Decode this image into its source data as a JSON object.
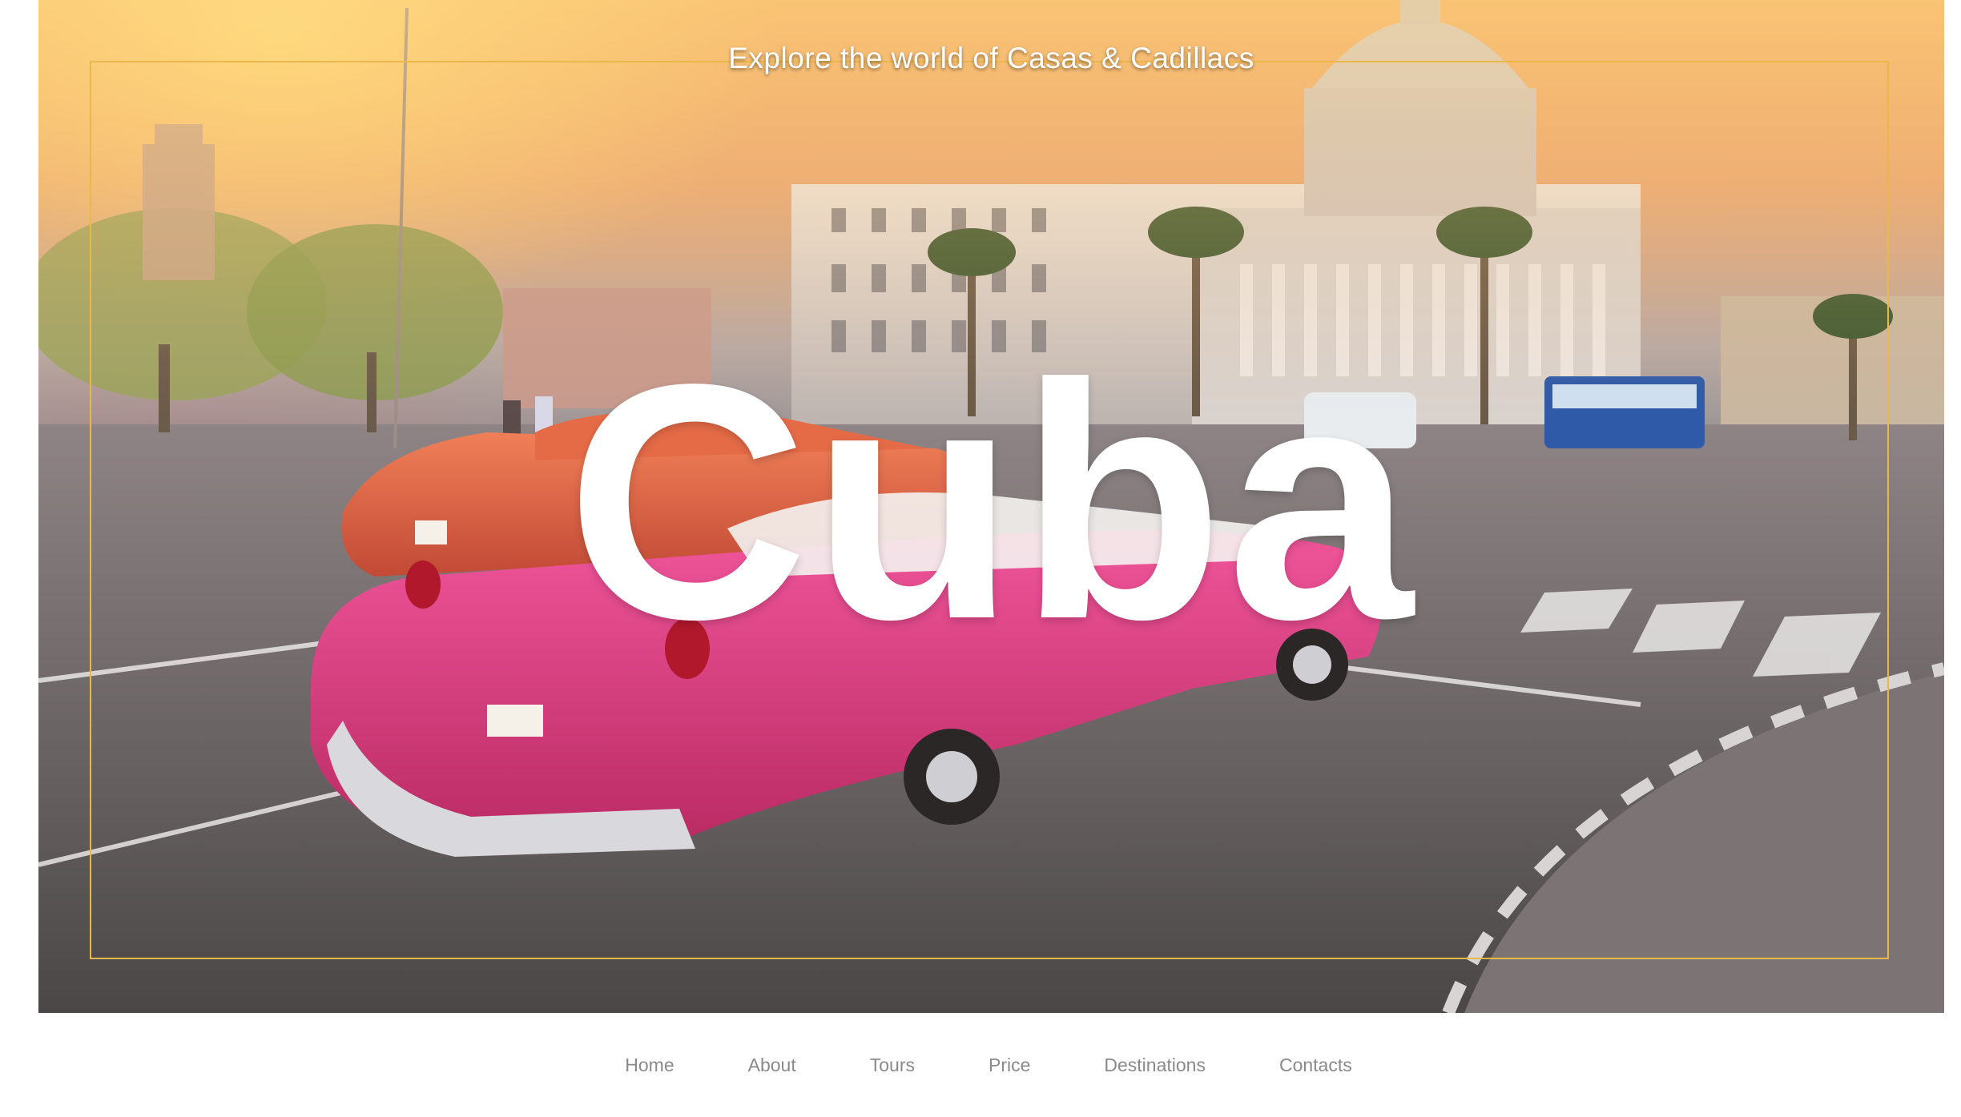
{
  "hero": {
    "tagline": "Explore the world of Casas & Cadillacs",
    "headline": "Cuba",
    "frame_color": "#e8b84a",
    "car_color": "#d8367a"
  },
  "nav": {
    "items": [
      {
        "label": "Home"
      },
      {
        "label": "About"
      },
      {
        "label": "Tours"
      },
      {
        "label": "Price"
      },
      {
        "label": "Destinations"
      },
      {
        "label": "Contacts"
      }
    ]
  },
  "colors": {
    "nav_text": "#8a8a8a",
    "background": "#ffffff"
  }
}
